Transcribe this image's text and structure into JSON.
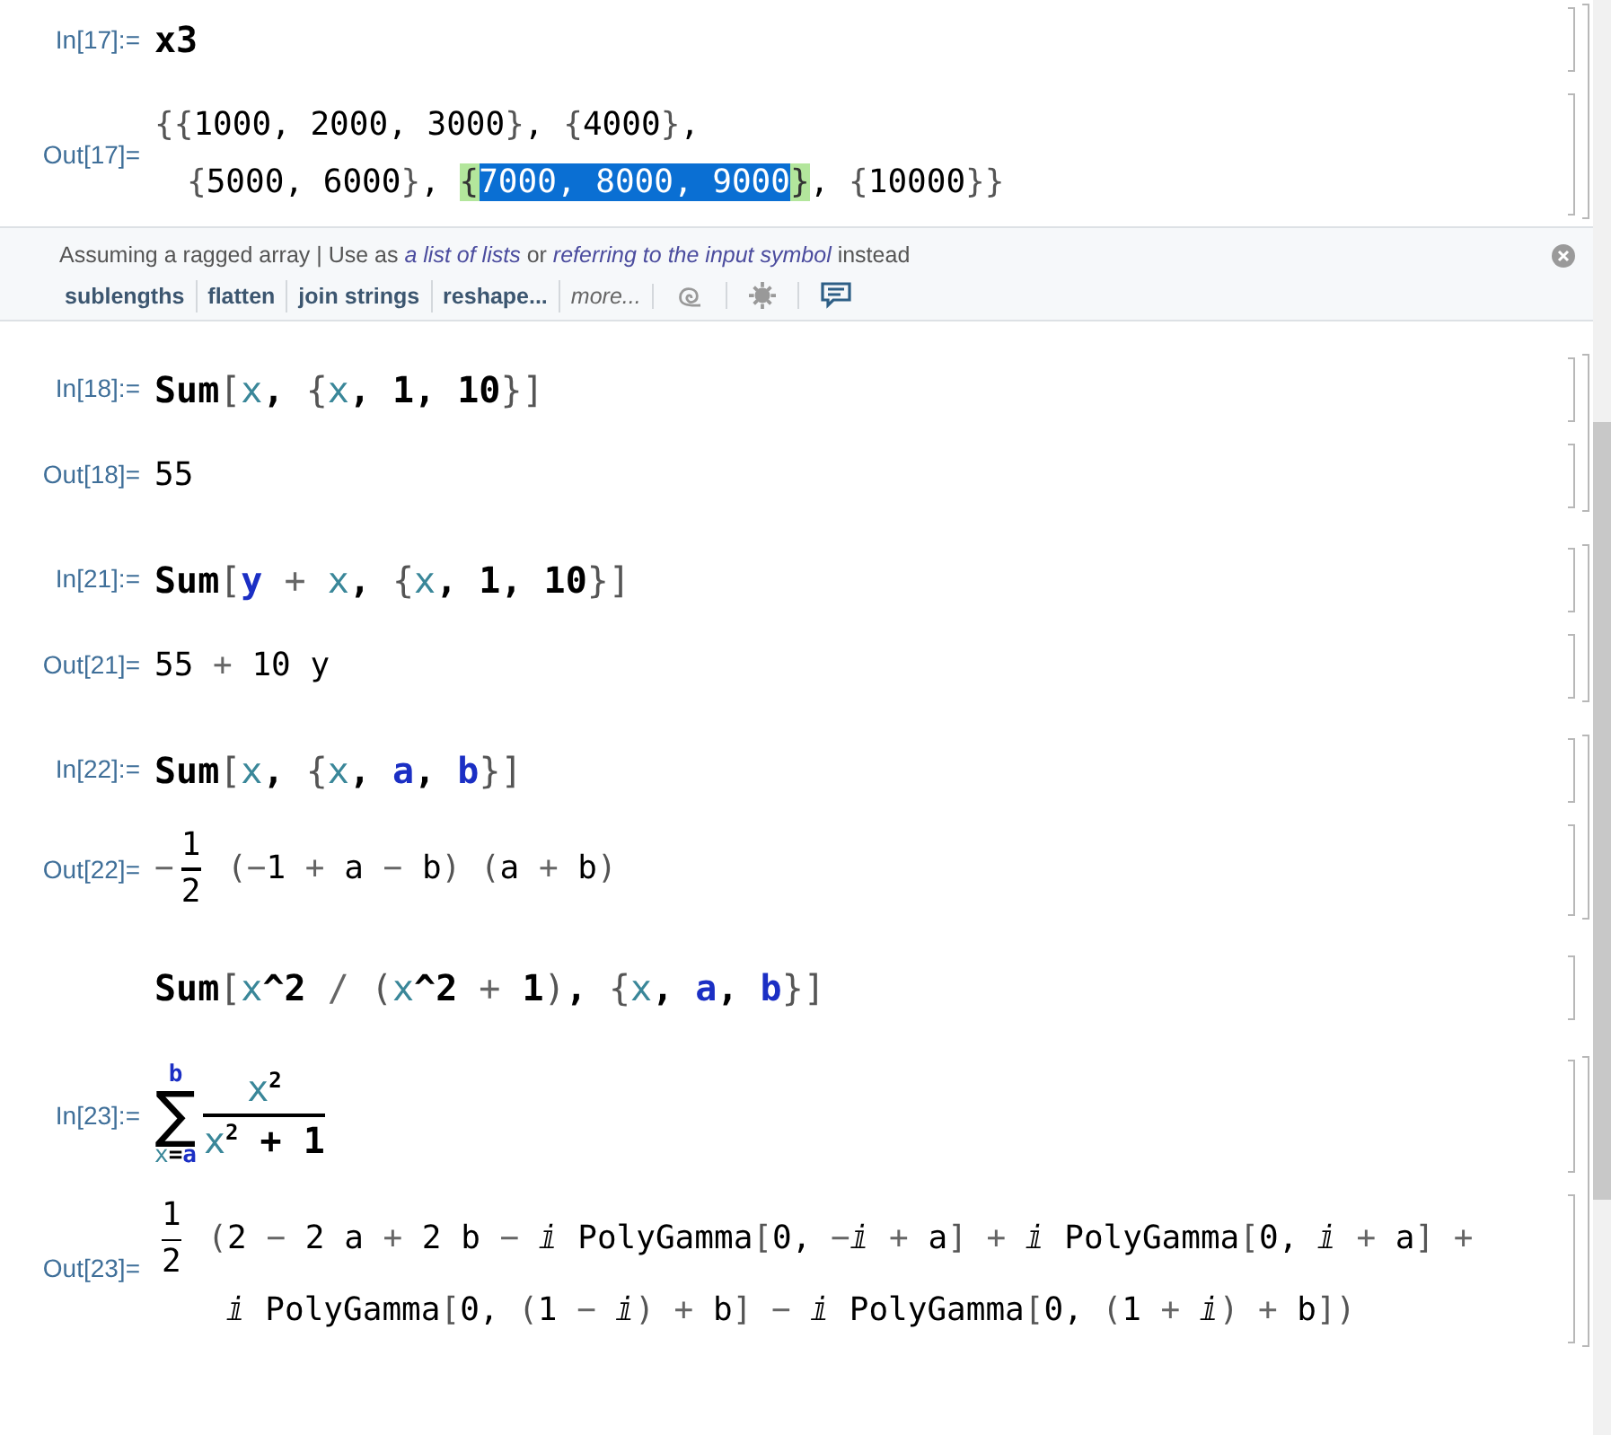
{
  "groups": [
    {
      "kind": "cells",
      "cells": [
        {
          "kind": "input",
          "label": "In[17]:=",
          "lines": [
            [
              {
                "kind": "bold",
                "text": "x3"
              }
            ]
          ]
        },
        {
          "kind": "output",
          "label": "Out[17]=",
          "lines": [
            [
              {
                "kind": "brace",
                "text": "{{"
              },
              {
                "kind": "plain",
                "text": "1000, 2000, 3000"
              },
              {
                "kind": "brace",
                "text": "}"
              },
              {
                "kind": "plain",
                "text": ", "
              },
              {
                "kind": "brace",
                "text": "{"
              },
              {
                "kind": "plain",
                "text": "4000"
              },
              {
                "kind": "brace",
                "text": "}"
              },
              {
                "kind": "plain",
                "text": ","
              }
            ],
            [
              {
                "kind": "brace",
                "text": "{"
              },
              {
                "kind": "plain",
                "text": "5000, 6000"
              },
              {
                "kind": "brace",
                "text": "}"
              },
              {
                "kind": "plain",
                "text": ", "
              },
              {
                "kind": "match",
                "text": "{"
              },
              {
                "kind": "sel",
                "text": "7000, 8000, 9000"
              },
              {
                "kind": "match",
                "text": "}"
              },
              {
                "kind": "plain",
                "text": ", "
              },
              {
                "kind": "brace",
                "text": "{"
              },
              {
                "kind": "plain",
                "text": "10000"
              },
              {
                "kind": "brace",
                "text": "}}"
              }
            ]
          ]
        }
      ]
    },
    {
      "kind": "suggestions",
      "sentence": [
        {
          "text": "Assuming a ragged array | Use as ",
          "link": false
        },
        {
          "text": "a list of lists",
          "link": true
        },
        {
          "text": " or ",
          "link": false
        },
        {
          "text": "referring to the input symbol",
          "link": true
        },
        {
          "text": " instead",
          "link": false
        }
      ],
      "buttons": [
        {
          "label": "sublengths",
          "italic": false
        },
        {
          "label": "flatten",
          "italic": false
        },
        {
          "label": "join strings",
          "italic": false
        },
        {
          "label": "reshape...",
          "italic": false
        },
        {
          "label": "more...",
          "italic": true
        }
      ]
    },
    {
      "kind": "cells",
      "cells": [
        {
          "kind": "input",
          "label": "In[18]:=",
          "lines": [
            [
              {
                "kind": "bold",
                "text": "Sum"
              },
              {
                "kind": "brace",
                "text": "["
              },
              {
                "kind": "var",
                "text": "x"
              },
              {
                "kind": "bold",
                "text": ", "
              },
              {
                "kind": "brace",
                "text": "{"
              },
              {
                "kind": "var",
                "text": "x"
              },
              {
                "kind": "bold",
                "text": ", 1, 10"
              },
              {
                "kind": "brace",
                "text": "}]"
              }
            ]
          ]
        },
        {
          "kind": "output",
          "label": "Out[18]=",
          "lines": [
            [
              {
                "kind": "plain",
                "text": "55"
              }
            ]
          ]
        }
      ]
    },
    {
      "kind": "cells",
      "cells": [
        {
          "kind": "input",
          "label": "In[21]:=",
          "lines": [
            [
              {
                "kind": "bold",
                "text": "Sum"
              },
              {
                "kind": "brace",
                "text": "["
              },
              {
                "kind": "sym",
                "text": "y"
              },
              {
                "kind": "op",
                "text": " + "
              },
              {
                "kind": "var",
                "text": "x"
              },
              {
                "kind": "bold",
                "text": ", "
              },
              {
                "kind": "brace",
                "text": "{"
              },
              {
                "kind": "var",
                "text": "x"
              },
              {
                "kind": "bold",
                "text": ", 1, 10"
              },
              {
                "kind": "brace",
                "text": "}]"
              }
            ]
          ]
        },
        {
          "kind": "output",
          "label": "Out[21]=",
          "lines": [
            [
              {
                "kind": "plain",
                "text": "55"
              },
              {
                "kind": "op",
                "text": " + "
              },
              {
                "kind": "plain",
                "text": "10 y"
              }
            ]
          ]
        }
      ]
    },
    {
      "kind": "cells",
      "cells": [
        {
          "kind": "input",
          "label": "In[22]:=",
          "lines": [
            [
              {
                "kind": "bold",
                "text": "Sum"
              },
              {
                "kind": "brace",
                "text": "["
              },
              {
                "kind": "var",
                "text": "x"
              },
              {
                "kind": "bold",
                "text": ", "
              },
              {
                "kind": "brace",
                "text": "{"
              },
              {
                "kind": "var",
                "text": "x"
              },
              {
                "kind": "bold",
                "text": ", "
              },
              {
                "kind": "sym",
                "text": "a"
              },
              {
                "kind": "bold",
                "text": ", "
              },
              {
                "kind": "sym",
                "text": "b"
              },
              {
                "kind": "brace",
                "text": "}]"
              }
            ]
          ]
        },
        {
          "kind": "output",
          "label": "Out[22]=",
          "lines": [
            [
              {
                "kind": "op",
                "text": "−"
              },
              {
                "kind": "frac",
                "num": [
                  {
                    "kind": "plain",
                    "text": "1"
                  }
                ],
                "den": [
                  {
                    "kind": "plain",
                    "text": "2"
                  }
                ]
              },
              {
                "kind": "brace",
                "text": " ("
              },
              {
                "kind": "op",
                "text": "−"
              },
              {
                "kind": "plain",
                "text": "1"
              },
              {
                "kind": "op",
                "text": " + "
              },
              {
                "kind": "plain",
                "text": "a"
              },
              {
                "kind": "op",
                "text": " − "
              },
              {
                "kind": "plain",
                "text": "b"
              },
              {
                "kind": "brace",
                "text": ") ("
              },
              {
                "kind": "plain",
                "text": "a"
              },
              {
                "kind": "op",
                "text": " + "
              },
              {
                "kind": "plain",
                "text": "b"
              },
              {
                "kind": "brace",
                "text": ")"
              }
            ]
          ]
        }
      ]
    },
    {
      "kind": "cells",
      "cells": [
        {
          "kind": "input",
          "lines": [
            [
              {
                "kind": "bold",
                "text": "Sum"
              },
              {
                "kind": "brace",
                "text": "["
              },
              {
                "kind": "var",
                "text": "x"
              },
              {
                "kind": "bold",
                "text": "^2"
              },
              {
                "kind": "op",
                "text": " / "
              },
              {
                "kind": "brace",
                "text": "("
              },
              {
                "kind": "var",
                "text": "x"
              },
              {
                "kind": "bold",
                "text": "^2"
              },
              {
                "kind": "op",
                "text": " + "
              },
              {
                "kind": "bold",
                "text": "1"
              },
              {
                "kind": "brace",
                "text": ")"
              },
              {
                "kind": "bold",
                "text": ", "
              },
              {
                "kind": "brace",
                "text": "{"
              },
              {
                "kind": "var",
                "text": "x"
              },
              {
                "kind": "bold",
                "text": ", "
              },
              {
                "kind": "sym",
                "text": "a"
              },
              {
                "kind": "bold",
                "text": ", "
              },
              {
                "kind": "sym",
                "text": "b"
              },
              {
                "kind": "brace",
                "text": "}]"
              }
            ]
          ]
        }
      ]
    },
    {
      "kind": "cells",
      "cells": [
        {
          "kind": "input",
          "label": "In[23]:=",
          "lines": [
            [
              {
                "kind": "sum",
                "symbol": "∑",
                "upper": [
                  {
                    "kind": "sym",
                    "text": "b"
                  }
                ],
                "lower": [
                  {
                    "kind": "var",
                    "text": "x"
                  },
                  {
                    "kind": "bold",
                    "text": "="
                  },
                  {
                    "kind": "sym",
                    "text": "a"
                  }
                ],
                "body": [
                  {
                    "kind": "frac",
                    "num": [
                      {
                        "kind": "var",
                        "text": "x"
                      },
                      {
                        "kind": "sup",
                        "text": "2"
                      }
                    ],
                    "den": [
                      {
                        "kind": "var",
                        "text": "x"
                      },
                      {
                        "kind": "sup",
                        "text": "2"
                      },
                      {
                        "kind": "bold",
                        "text": " + 1"
                      }
                    ]
                  }
                ]
              }
            ]
          ]
        },
        {
          "kind": "output",
          "label": "Out[23]=",
          "lines": [
            [
              {
                "kind": "frac",
                "num": [
                  {
                    "kind": "plain",
                    "text": "1"
                  }
                ],
                "den": [
                  {
                    "kind": "plain",
                    "text": "2"
                  }
                ]
              },
              {
                "kind": "brace",
                "text": " ("
              },
              {
                "kind": "plain",
                "text": "2"
              },
              {
                "kind": "op",
                "text": " − "
              },
              {
                "kind": "plain",
                "text": "2 a"
              },
              {
                "kind": "op",
                "text": " + "
              },
              {
                "kind": "plain",
                "text": "2 b"
              },
              {
                "kind": "op",
                "text": " − "
              },
              {
                "kind": "plain",
                "text": "ⅈ PolyGamma"
              },
              {
                "kind": "brace",
                "text": "["
              },
              {
                "kind": "plain",
                "text": "0, "
              },
              {
                "kind": "op",
                "text": "−"
              },
              {
                "kind": "plain",
                "text": "ⅈ"
              },
              {
                "kind": "op",
                "text": " + "
              },
              {
                "kind": "plain",
                "text": "a"
              },
              {
                "kind": "brace",
                "text": "]"
              },
              {
                "kind": "op",
                "text": " + "
              },
              {
                "kind": "plain",
                "text": "ⅈ PolyGamma"
              },
              {
                "kind": "brace",
                "text": "["
              },
              {
                "kind": "plain",
                "text": "0, ⅈ"
              },
              {
                "kind": "op",
                "text": " + "
              },
              {
                "kind": "plain",
                "text": "a"
              },
              {
                "kind": "brace",
                "text": "]"
              },
              {
                "kind": "op",
                "text": " +"
              }
            ],
            [
              {
                "kind": "plain",
                "text": "ⅈ PolyGamma"
              },
              {
                "kind": "brace",
                "text": "["
              },
              {
                "kind": "plain",
                "text": "0, "
              },
              {
                "kind": "brace",
                "text": "("
              },
              {
                "kind": "plain",
                "text": "1"
              },
              {
                "kind": "op",
                "text": " − "
              },
              {
                "kind": "plain",
                "text": "ⅈ"
              },
              {
                "kind": "brace",
                "text": ")"
              },
              {
                "kind": "op",
                "text": " + "
              },
              {
                "kind": "plain",
                "text": "b"
              },
              {
                "kind": "brace",
                "text": "]"
              },
              {
                "kind": "op",
                "text": " − "
              },
              {
                "kind": "plain",
                "text": "ⅈ PolyGamma"
              },
              {
                "kind": "brace",
                "text": "["
              },
              {
                "kind": "plain",
                "text": "0, "
              },
              {
                "kind": "brace",
                "text": "("
              },
              {
                "kind": "plain",
                "text": "1"
              },
              {
                "kind": "op",
                "text": " + "
              },
              {
                "kind": "plain",
                "text": "ⅈ"
              },
              {
                "kind": "brace",
                "text": ")"
              },
              {
                "kind": "op",
                "text": " + "
              },
              {
                "kind": "plain",
                "text": "b"
              },
              {
                "kind": "brace",
                "text": "])"
              }
            ]
          ]
        }
      ]
    }
  ]
}
